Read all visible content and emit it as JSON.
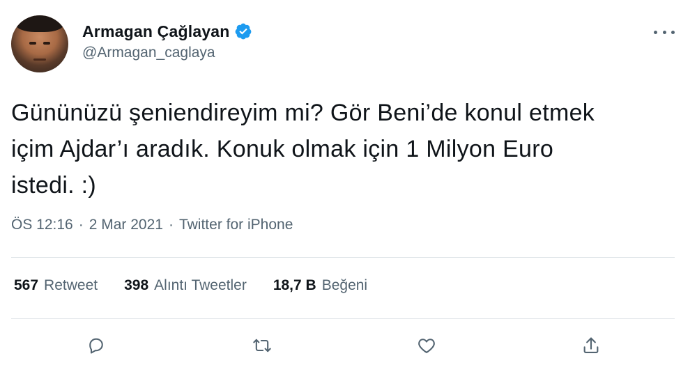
{
  "user": {
    "display_name": "Armagan Çağlayan",
    "handle": "@Armagan_caglaya",
    "verified_icon": "verified-badge-icon",
    "avatar_icon": "avatar"
  },
  "tweet": {
    "text": "Gününüzü şeniendireyim mi? Gör Beni’de konul etmek\niçim Ajdar’ı aradık. Konuk olmak için 1 Milyon Euro\nistedi. :)",
    "time": "ÖS 12:16",
    "separator": "·",
    "date": "2 Mar 2021",
    "source": "Twitter for iPhone"
  },
  "stats": {
    "retweets_count": "567",
    "retweets_label": "Retweet",
    "quotes_count": "398",
    "quotes_label": "Alıntı Tweetler",
    "likes_count": "18,7 B",
    "likes_label": "Beğeni"
  },
  "actions": {
    "reply_icon": "reply-icon",
    "retweet_icon": "retweet-icon",
    "like_icon": "heart-icon",
    "share_icon": "share-icon",
    "more_icon": "more-icon"
  },
  "colors": {
    "text_primary": "#0f1419",
    "text_secondary": "#536471",
    "verified_blue": "#1d9bf0",
    "divider": "#dfe4e8"
  }
}
